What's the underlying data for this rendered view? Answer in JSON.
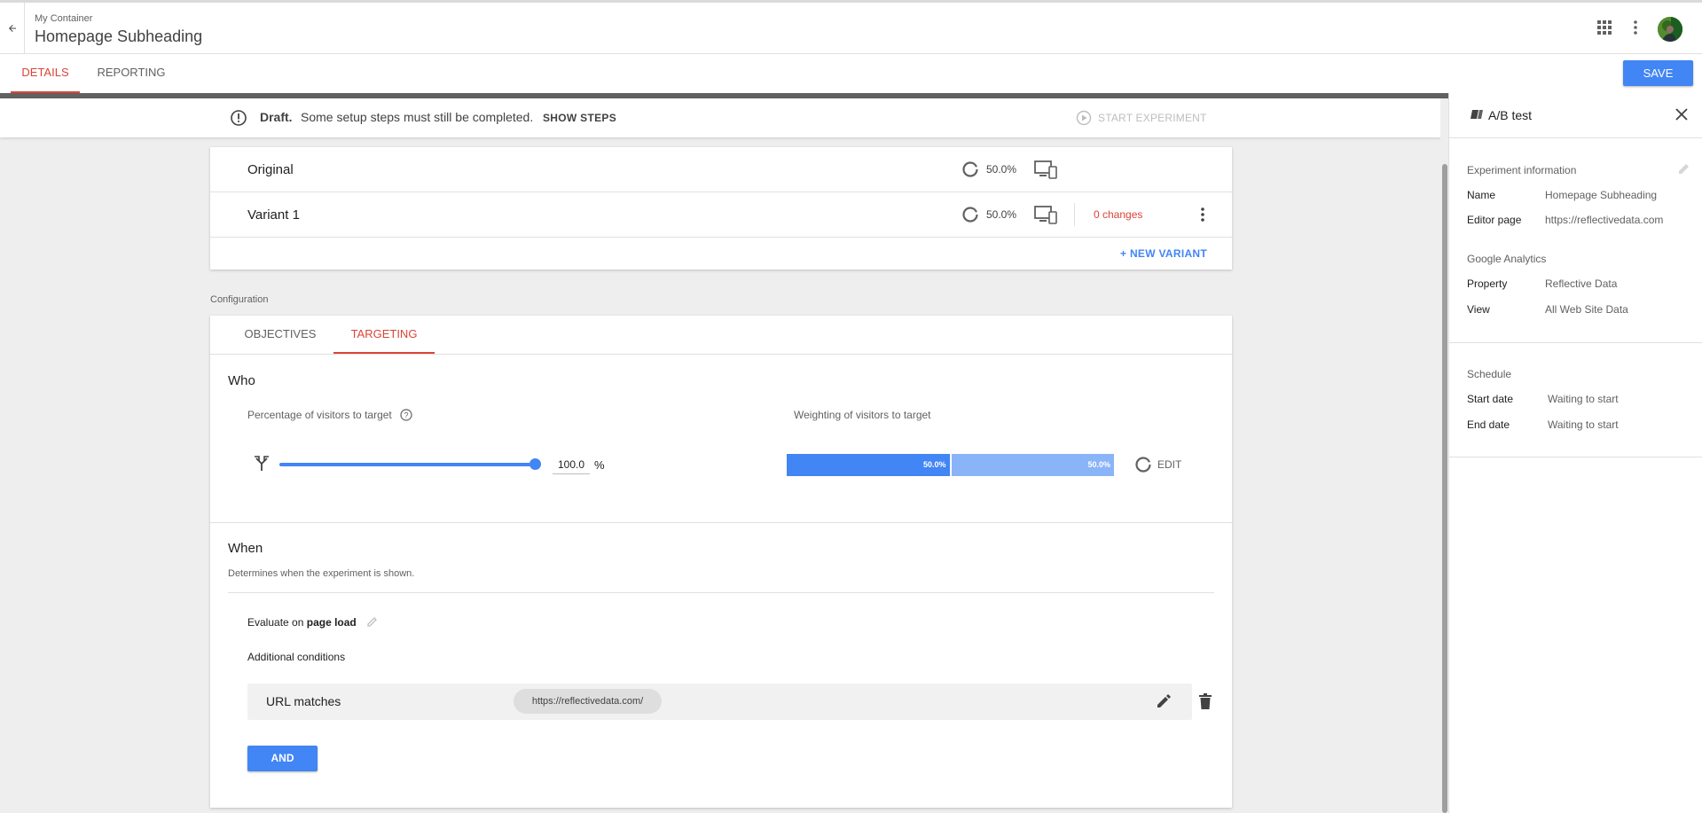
{
  "header": {
    "container_label": "My Container",
    "title": "Homepage Subheading"
  },
  "tabs": [
    {
      "label": "DETAILS",
      "active": true
    },
    {
      "label": "REPORTING",
      "active": false
    }
  ],
  "toolbar": {
    "save_label": "SAVE"
  },
  "draft": {
    "label": "Draft.",
    "message": "Some setup steps must still be completed.",
    "show_steps": "SHOW STEPS",
    "start_experiment": "START EXPERIMENT"
  },
  "variants": [
    {
      "name": "Original",
      "weight": "50.0%"
    },
    {
      "name": "Variant 1",
      "weight": "50.0%",
      "changes": "0 changes"
    }
  ],
  "new_variant_label": "+ NEW VARIANT",
  "configuration": {
    "section_label": "Configuration",
    "tabs": [
      {
        "label": "OBJECTIVES",
        "active": false
      },
      {
        "label": "TARGETING",
        "active": true
      }
    ],
    "who": {
      "title": "Who",
      "percentage_label": "Percentage of visitors to target",
      "percentage_value": "100.0",
      "percentage_unit": "%",
      "weighting_label": "Weighting of visitors to target",
      "weights": [
        {
          "label": "50.0%",
          "fraction": 0.5,
          "color": "#4285f4"
        },
        {
          "label": "50.0%",
          "fraction": 0.5,
          "color": "#8ab4f8"
        }
      ],
      "edit_label": "EDIT"
    },
    "when": {
      "title": "When",
      "description": "Determines when the experiment is shown.",
      "evaluate_prefix": "Evaluate on",
      "evaluate_trigger": "page load",
      "additional_conditions_label": "Additional conditions",
      "condition": {
        "label": "URL matches",
        "value": "https://reflectivedata.com/"
      },
      "and_label": "AND"
    }
  },
  "panel": {
    "title": "A/B test",
    "experiment_info": {
      "label": "Experiment information",
      "name_key": "Name",
      "name_value": "Homepage Subheading",
      "editor_key": "Editor page",
      "editor_value": "https://reflectivedata.com"
    },
    "google_analytics": {
      "label": "Google Analytics",
      "property_key": "Property",
      "property_value": "Reflective Data",
      "view_key": "View",
      "view_value": "All Web Site Data"
    },
    "schedule": {
      "label": "Schedule",
      "start_key": "Start date",
      "start_value": "Waiting to start",
      "end_key": "End date",
      "end_value": "Waiting to start"
    }
  },
  "colors": {
    "accent_red": "#db4437",
    "primary_blue": "#4285f4",
    "light_blue": "#8ab4f8"
  },
  "icons": [
    "back-arrow-icon",
    "apps-grid-icon",
    "more-vert-icon",
    "avatar",
    "alert-circle-icon",
    "play-circle-icon",
    "ring-icon",
    "device-icon",
    "help-icon",
    "split-icon",
    "pencil-icon",
    "trash-icon",
    "experiment-icon",
    "close-icon"
  ]
}
